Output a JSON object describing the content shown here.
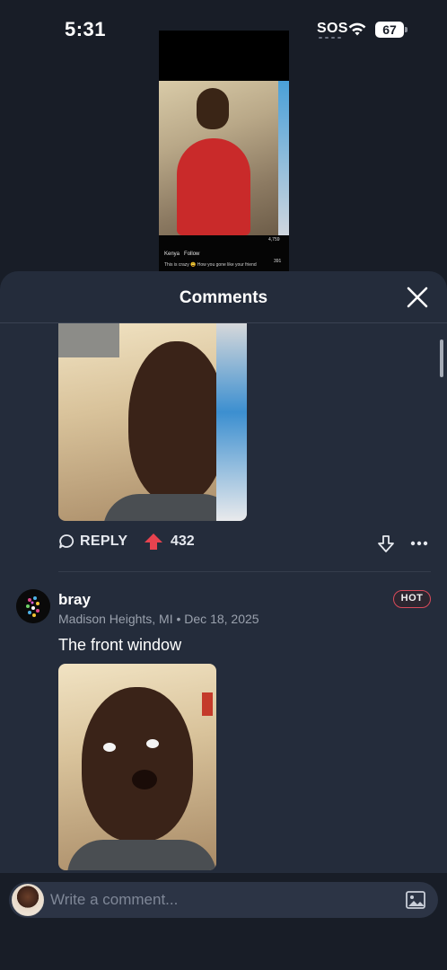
{
  "status_bar": {
    "time": "5:31",
    "carrier": "SOS",
    "battery": "67"
  },
  "video": {
    "username": "Kenya",
    "follow_label": "Follow",
    "caption": "This is crazy 😩 How you gone like your friend",
    "like_count": "4,759",
    "share_count": "391"
  },
  "sheet": {
    "title": "Comments",
    "close_icon": "close-icon"
  },
  "comments": [
    {
      "actions": {
        "reply_label": "REPLY",
        "upvotes": "432"
      }
    },
    {
      "author": "bray",
      "meta": "Madison Heights, MI • Dec 18, 2025",
      "badge": "HOT",
      "text": "The front window"
    }
  ],
  "composer": {
    "placeholder": "Write a comment..."
  },
  "colors": {
    "background": "#181d27",
    "sheet": "#242c3b",
    "upvote": "#e8434f",
    "hot_badge_border": "#d94a5a"
  }
}
